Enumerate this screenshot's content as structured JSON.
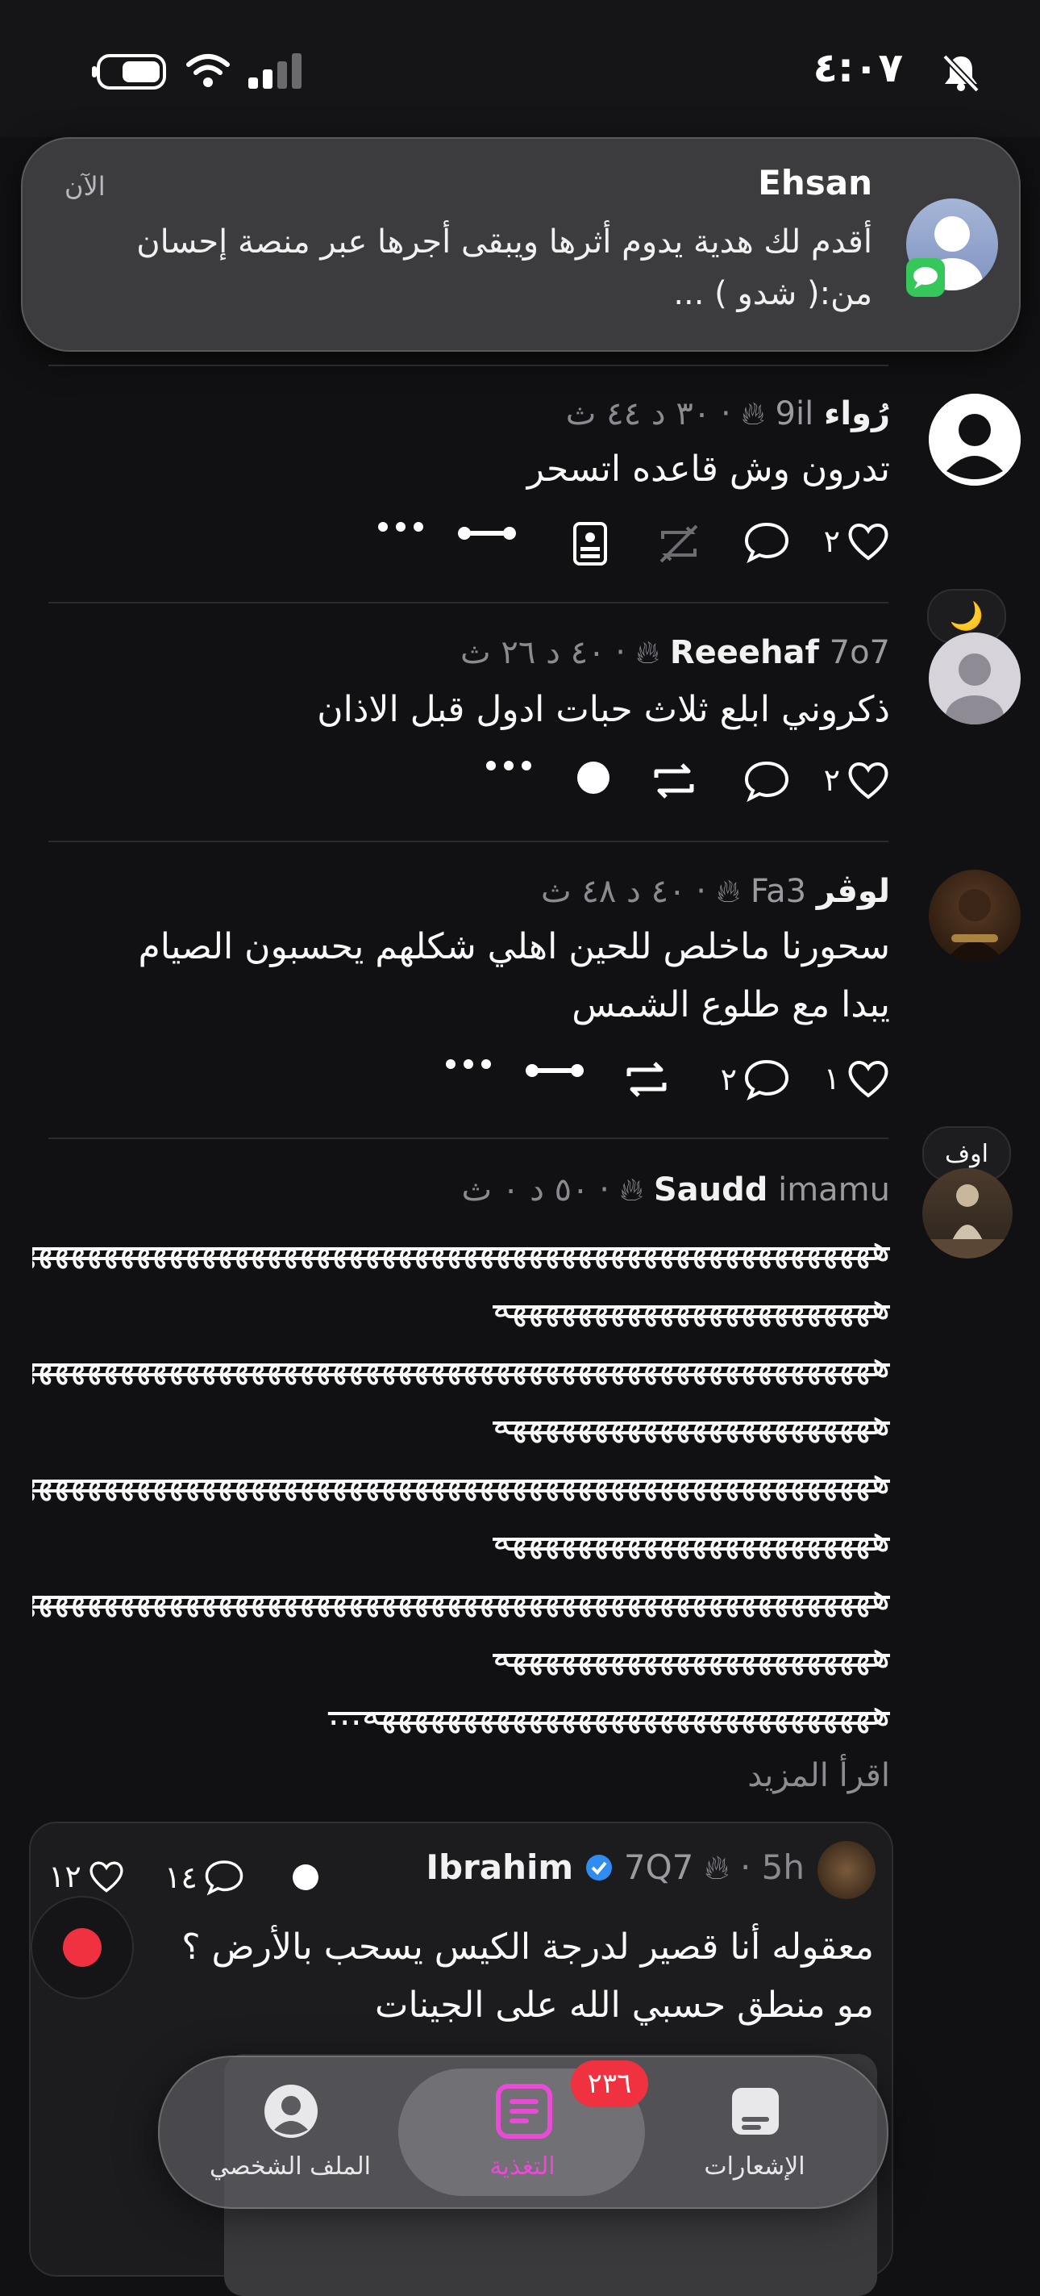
{
  "status_bar": {
    "time": "٤:٠٧"
  },
  "notification": {
    "sender": "Ehsan",
    "time": "الآن",
    "body": "أقدم لك هدية يدوم أثرها ويبقى أجرها عبر منصة إحسان من:( شدو ) ..."
  },
  "posts": [
    {
      "name": "رُواء",
      "handle": "9il",
      "meta": "٣٠ د ٤٤ ث",
      "text": "تدرون وش قاعده اتسحر",
      "likes": "٢",
      "comments": ""
    },
    {
      "name": "Reeehaf",
      "handle": "7o7",
      "meta": "٤٠ د ٢٦ ث",
      "text": "ذكروني ابلع ثلاث حبات ادول قبل الاذان",
      "likes": "٢",
      "comments": "",
      "badge": "🌙"
    },
    {
      "name": "لوڤر",
      "handle": "Fa3",
      "meta": "٤٠ د ٤٨ ث",
      "text_lines": [
        "سحورنا ماخلص للحين اهلي شكلهم يحسبون الصيام",
        "يبدا مع طلوع الشمس"
      ],
      "likes": "١",
      "comments": "٢"
    },
    {
      "name": "Saudd",
      "handle": "imamu",
      "meta": "٥٠ د ٠ ث",
      "badge": "اوف",
      "text_lines": [
        "ههههههههههههههههههههههههههههههههههههههههههههههههههههههه",
        "هههههههههههههههههههههههه",
        "ههههههههههههههههههههههههههههههههههههههههههههههههههههههه",
        "هههههههههههههههههههههههه",
        "ههههههههههههههههههههههههههههههههههههههههههههههههههههههه",
        "هههههههههههههههههههههههه",
        "ههههههههههههههههههههههههههههههههههههههههههههههههههههههه",
        "هههههههههههههههههههههههه",
        "هههههههههههههههههههههههههههههههه..."
      ],
      "read_more": "اقرأ المزيد"
    }
  ],
  "quoted_post": {
    "name": "Ibrahim",
    "handle": "7Q7",
    "meta": "5h",
    "likes": "١٢",
    "comments": "١٤",
    "text_lines": [
      "معقوله أنا قصير لدرجة الكيس يسحب بالأرض ؟",
      "مو منطق حسبي الله على الجينات"
    ]
  },
  "tab_bar": {
    "tabs": [
      {
        "label": "الملف الشخصي",
        "icon": "profile-icon"
      },
      {
        "label": "التغذية",
        "icon": "feed-icon"
      },
      {
        "label": "الإشعارات",
        "icon": "notifications-icon",
        "badge": "٢٣٦"
      }
    ]
  },
  "colors": {
    "accent": "#e94bd6",
    "badge_red": "#f0313f",
    "background": "#111113"
  }
}
